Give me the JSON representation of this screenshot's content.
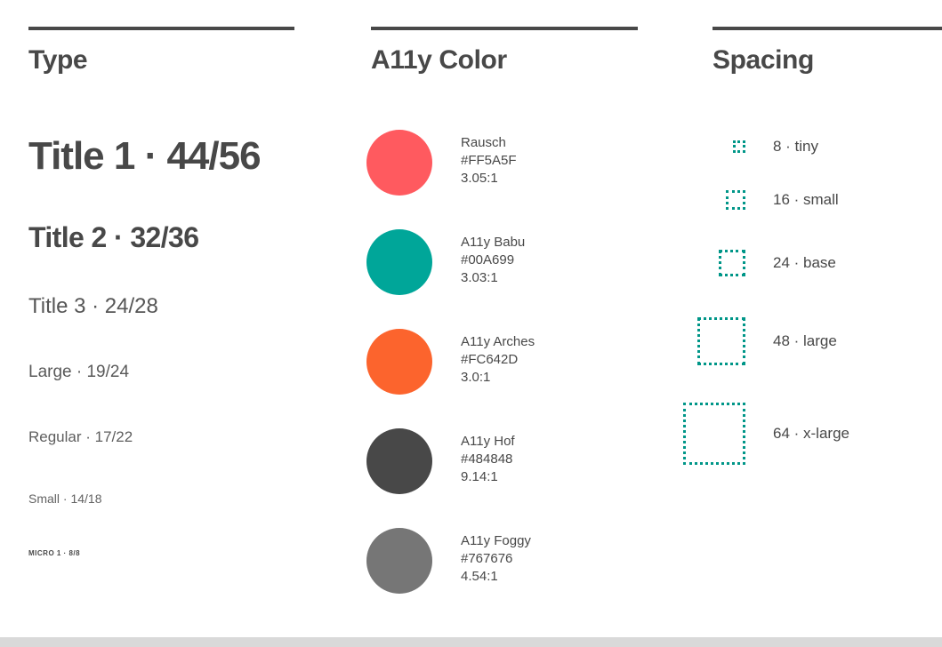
{
  "columns": {
    "type": {
      "heading": "Type",
      "specimens": [
        {
          "label": "Title 1 · 44/56"
        },
        {
          "label": "Title 2 · 32/36"
        },
        {
          "label": "Title 3 · 24/28"
        },
        {
          "label": "Large · 19/24"
        },
        {
          "label": "Regular · 17/22"
        },
        {
          "label": "Small · 14/18"
        },
        {
          "label": "MICRO 1 · 8/8"
        }
      ]
    },
    "color": {
      "heading": "A11y Color",
      "swatches": [
        {
          "name": "Rausch",
          "hex": "#FF5A5F",
          "contrast": "3.05:1"
        },
        {
          "name": "A11y Babu",
          "hex": "#00A699",
          "contrast": "3.03:1"
        },
        {
          "name": "A11y Arches",
          "hex": "#FC642D",
          "contrast": "3.0:1"
        },
        {
          "name": "A11y Hof",
          "hex": "#484848",
          "contrast": "9.14:1"
        },
        {
          "name": "A11y Foggy",
          "hex": "#767676",
          "contrast": "4.54:1"
        }
      ]
    },
    "spacing": {
      "heading": "Spacing",
      "accent_color": "#009688",
      "tokens": [
        {
          "label": "8 · tiny",
          "size": 8
        },
        {
          "label": "16 · small",
          "size": 16
        },
        {
          "label": "24 · base",
          "size": 24
        },
        {
          "label": "48 · large",
          "size": 48
        },
        {
          "label": "64 · x-large",
          "size": 64
        }
      ]
    }
  },
  "theme": {
    "ink": "#484848",
    "rule_color": "#484848",
    "footer_strip": "#d9d9d9",
    "background": "#FFFFFF"
  }
}
